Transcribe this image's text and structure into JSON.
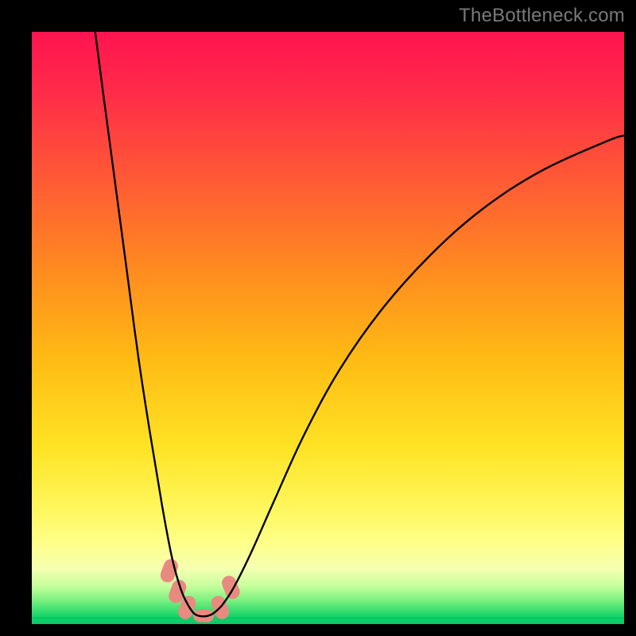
{
  "watermark": "TheBottleneck.com",
  "chart_data": {
    "type": "line",
    "title": "",
    "xlabel": "",
    "ylabel": "",
    "xlim": [
      0,
      100
    ],
    "ylim": [
      0,
      100
    ],
    "grid": false,
    "legend": false,
    "description": "Bottleneck-style V curve over a red-to-green vertical gradient with a green band at the bottom. Two curves descend steeply from the top edges toward a narrow minimum near x≈27, with short salmon highlight segments at the trough.",
    "series": [
      {
        "name": "left-branch",
        "x": [
          10.7,
          12,
          14,
          16,
          18,
          20,
          22,
          23.5,
          24.5,
          25.5,
          26.5
        ],
        "y": [
          100,
          90,
          75,
          60,
          45,
          32,
          20,
          12,
          8,
          5,
          3
        ]
      },
      {
        "name": "right-branch",
        "x": [
          32,
          34,
          37,
          41,
          46,
          52,
          59,
          67,
          76,
          86,
          97,
          100
        ],
        "y": [
          3,
          6,
          12,
          21,
          32,
          43,
          53,
          62,
          70,
          76.5,
          81.5,
          82.5
        ]
      },
      {
        "name": "trough",
        "x": [
          26.5,
          27.5,
          29.0,
          30.5,
          32
        ],
        "y": [
          3,
          1.7,
          1.3,
          1.7,
          3
        ]
      }
    ],
    "highlights": [
      {
        "name": "dot-left-upper",
        "x": 23.2,
        "y": 9.0
      },
      {
        "name": "dot-left-mid",
        "x": 24.6,
        "y": 5.5
      },
      {
        "name": "dot-left-low",
        "x": 26.2,
        "y": 2.8
      },
      {
        "name": "dot-bottom",
        "x": 29.0,
        "y": 1.4
      },
      {
        "name": "dot-right-low",
        "x": 31.8,
        "y": 2.8
      },
      {
        "name": "dot-right-upper",
        "x": 33.6,
        "y": 6.2
      }
    ],
    "gradient_stops": [
      {
        "offset": 0.0,
        "color": "#ff1450"
      },
      {
        "offset": 0.1,
        "color": "#ff2b49"
      },
      {
        "offset": 0.25,
        "color": "#ff5a35"
      },
      {
        "offset": 0.4,
        "color": "#ff8a20"
      },
      {
        "offset": 0.55,
        "color": "#ffba14"
      },
      {
        "offset": 0.7,
        "color": "#ffe324"
      },
      {
        "offset": 0.8,
        "color": "#fef65a"
      },
      {
        "offset": 0.86,
        "color": "#feff86"
      },
      {
        "offset": 0.905,
        "color": "#f6ffb0"
      },
      {
        "offset": 0.935,
        "color": "#c8ff9e"
      },
      {
        "offset": 0.96,
        "color": "#7af07f"
      },
      {
        "offset": 0.985,
        "color": "#1cd66a"
      },
      {
        "offset": 1.0,
        "color": "#07c867"
      }
    ],
    "colors": {
      "curve": "#000000",
      "highlight": "#e98a80",
      "green_line": "#07c867"
    }
  }
}
